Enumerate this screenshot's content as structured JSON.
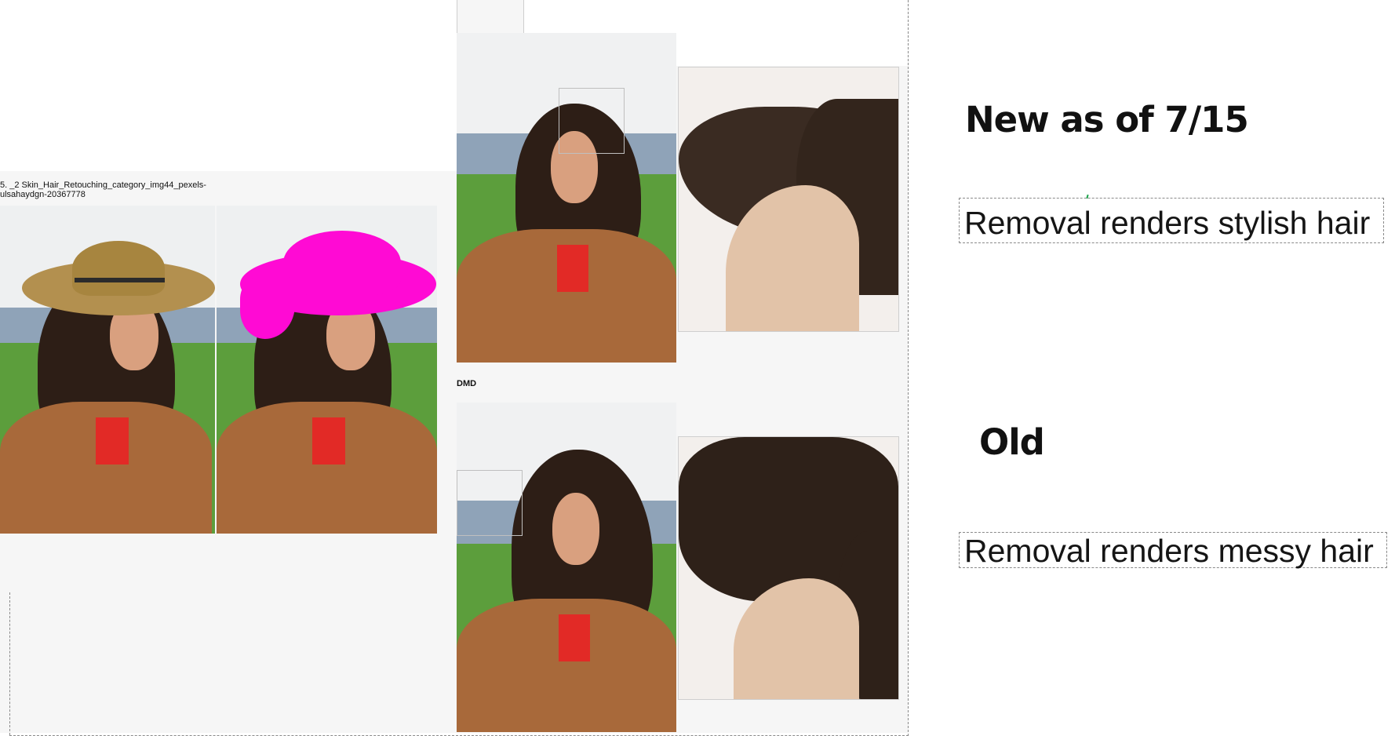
{
  "left_panel": {
    "caption_line1": "5. _2 Skin_Hair_Retouching_category_img44_pexels-",
    "caption_line2": "ulsahaydgn-20367778",
    "mask_color": "#ff0ad4"
  },
  "middle_panel": {
    "section_label": "DMD"
  },
  "right_notes": {
    "new_heading": "New as of 7/15",
    "new_note": "Removal renders stylish hair",
    "old_heading": "Old",
    "old_note": "Removal renders messy hair",
    "accent_color": "#1aa34a"
  }
}
